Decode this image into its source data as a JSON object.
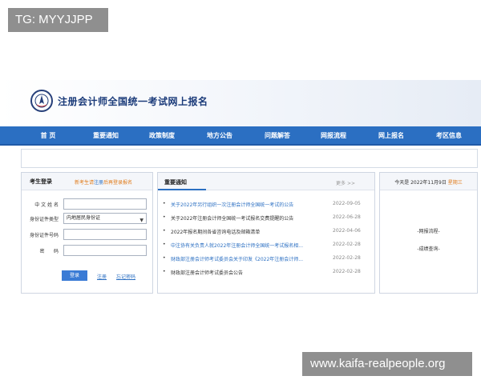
{
  "tag": "TG: MYYJJPP",
  "site_title": "注册会计师全国统一考试网上报名",
  "nav": [
    "首 页",
    "重要通知",
    "政策制度",
    "地方公告",
    "问题解答",
    "网报流程",
    "网上报名",
    "考区信息"
  ],
  "login": {
    "title": "考生登录",
    "hint_prefix": "新考生请",
    "hint_link": "注册",
    "hint_suffix": "后再登录报名",
    "fields": [
      {
        "label": "中 文 姓 名",
        "value": ""
      },
      {
        "label": "身份证件类型",
        "value": "内地居民身份证"
      },
      {
        "label": "身份证件号码",
        "value": ""
      },
      {
        "label": "密      码",
        "value": ""
      }
    ],
    "login_button": "登录",
    "register_link": "注册",
    "forgot_link": "忘记密码"
  },
  "news": {
    "title": "重要通知",
    "more": "更多 >>",
    "items": [
      {
        "text": "关于2022年另行组织一次注册会计师全国统一考试的公告",
        "date": "2022-09-05",
        "blue": true
      },
      {
        "text": "关于2022年注册会计师全国统一考试报名交费提醒的公告",
        "date": "2022-06-28",
        "blue": false
      },
      {
        "text": "2022年报名期间各省咨询电话及邮箱清单",
        "date": "2022-04-06",
        "blue": false
      },
      {
        "text": "中注协有关负责人就2022年注册会计师全国统一考试报名相...",
        "date": "2022-02-28",
        "blue": true
      },
      {
        "text": "财政部注册会计师考试委员会关于印发《2022年注册会计师...",
        "date": "2022-02-28",
        "blue": true
      },
      {
        "text": "财政部注册会计师考试委员会公告",
        "date": "2022-02-28",
        "blue": false
      }
    ]
  },
  "side": {
    "date_text": "今天是 2022年11月9日",
    "weekday": "星期三",
    "links": [
      "-网报流程-",
      "-成绩查询-"
    ]
  },
  "watermark": "www.kaifa-realpeople.org"
}
